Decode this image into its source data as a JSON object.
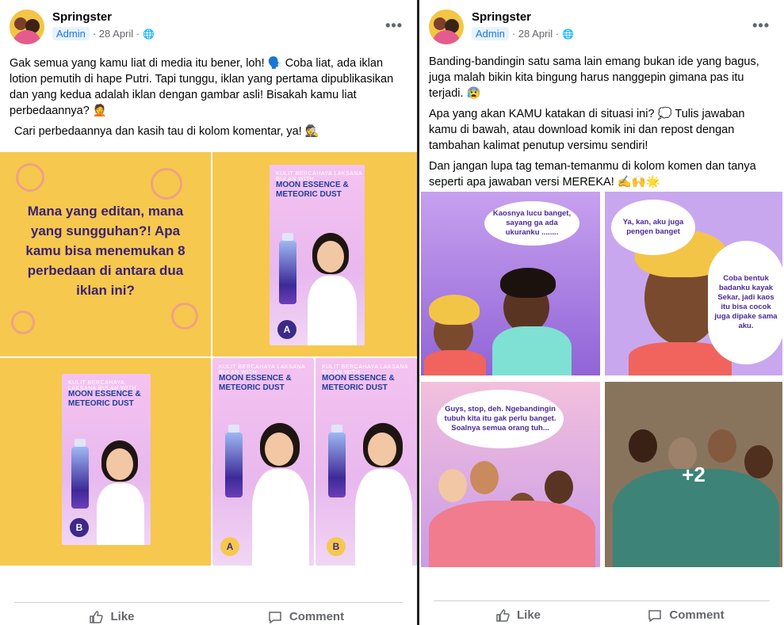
{
  "left_post": {
    "author": "Springster",
    "role_badge": "Admin",
    "date": "· 28 April ·",
    "globe": "🌐",
    "more": "•••",
    "paragraphs": [
      "Gak semua yang kamu liat di media itu bener, loh! 🗣️ Coba liat, ada iklan lotion pemutih di hape Putri. Tapi tunggu, iklan yang pertama dipublikasikan dan yang kedua adalah iklan dengan gambar asli! Bisakah kamu liat perbedaannya? 🤦",
      "Cari perbedaannya dan kasih tau di kolom komentar, ya! 🕵️"
    ],
    "intro_tile_text": "Mana yang editan, mana yang sungguhan?! Apa kamu bisa menemukan 8 perbedaan di antara dua iklan ini?",
    "ad_small_text": "KULIT BERCAHAYA LAKSANA BULAN WITH",
    "ad_big_text": "MOON ESSENCE & METEORIC DUST",
    "badges": [
      "A",
      "B",
      "A",
      "B"
    ],
    "like_label": "Like",
    "comment_label": "Comment"
  },
  "right_post": {
    "author": "Springster",
    "role_badge": "Admin",
    "date": "· 28 April ·",
    "globe": "🌐",
    "more": "•••",
    "paragraphs": [
      "Banding-bandingin satu sama lain emang bukan ide yang bagus, juga malah bikin kita bingung harus nanggepin gimana pas itu terjadi. 😰",
      "Apa yang akan KAMU katakan di situasi ini? 💭 Tulis jawaban kamu di bawah, atau download komik ini dan repost dengan tambahan kalimat penutup versimu sendiri!",
      "Dan jangan lupa tag teman-temanmu di kolom komen dan tanya seperti apa jawaban versi MEREKA! ✍️🙌🌟"
    ],
    "bubbles": [
      "Kaosnya lucu banget, sayang ga ada ukuranku ........",
      "Ya, kan, aku juga pengen banget",
      "Coba bentuk badanku kayak Sekar, jadi kaos itu bisa cocok juga dipake sama aku.",
      "Guys, stop, deh. Ngebandingin tubuh kita itu gak perlu banget. Soalnya semua orang tuh..."
    ],
    "more_count": "+2",
    "like_label": "Like",
    "comment_label": "Comment"
  },
  "colors": {
    "panel_yellow": "#f6c84e",
    "ad_pink": "#f2c4ef",
    "comic_purple": "#b58be6",
    "badge_blue": "#1b74e4"
  }
}
